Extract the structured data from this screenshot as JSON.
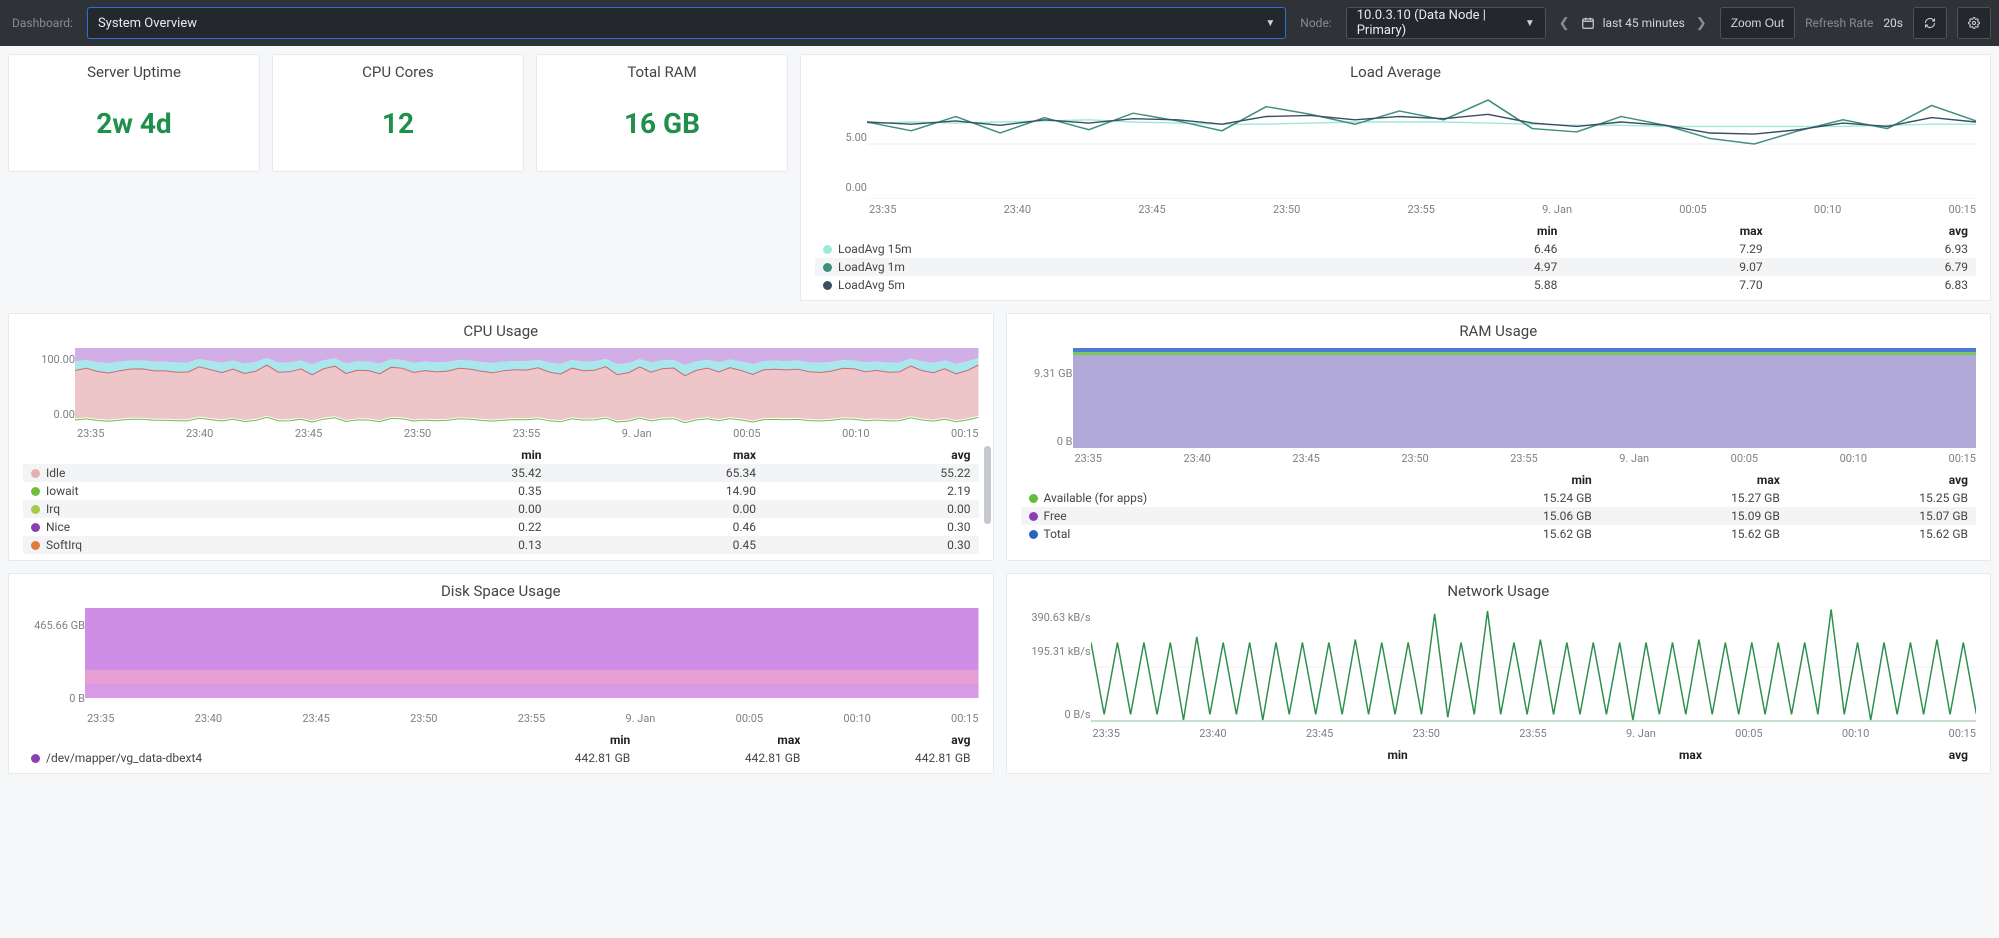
{
  "topbar": {
    "dashboard_lbl": "Dashboard:",
    "dashboard_value": "System Overview",
    "node_lbl": "Node:",
    "node_value": "10.0.3.10 (Data Node | Primary)",
    "range_text": "last 45 minutes",
    "zoom_out": "Zoom Out",
    "refresh_lbl": "Refresh Rate",
    "refresh_val": "20s"
  },
  "stats": {
    "uptime_title": "Server Uptime",
    "uptime_value": "2w 4d",
    "cores_title": "CPU Cores",
    "cores_value": "12",
    "ram_title": "Total RAM",
    "ram_value": "16 GB"
  },
  "xticks": [
    "23:35",
    "23:40",
    "23:45",
    "23:50",
    "23:55",
    "9. Jan",
    "00:05",
    "00:10",
    "00:15"
  ],
  "chart_data": [
    {
      "id": "load",
      "title": "Load Average",
      "type": "line",
      "ylabel": "",
      "yticks": [
        "5.00",
        "0.00"
      ],
      "ylim": [
        0,
        10
      ],
      "x": [
        "23:35",
        "23:40",
        "23:45",
        "23:50",
        "23:55",
        "9. Jan",
        "00:05",
        "00:10",
        "00:15"
      ],
      "series": [
        {
          "name": "LoadAvg 15m",
          "color": "#9fe9d8",
          "min": 6.46,
          "max": 7.29,
          "avg": 6.93,
          "values": [
            6.9,
            7.0,
            6.9,
            7.0,
            7.1,
            7.2,
            7.0,
            6.9,
            6.8,
            6.8,
            6.9,
            7.0,
            7.0,
            7.0,
            6.9,
            6.8,
            6.7,
            6.7,
            6.6,
            6.6,
            6.6,
            6.6,
            6.6,
            6.7,
            6.8,
            6.8
          ]
        },
        {
          "name": "LoadAvg 1m",
          "color": "#3f8f7e",
          "min": 4.97,
          "max": 9.07,
          "avg": 6.79,
          "values": [
            7.0,
            6.2,
            7.5,
            6.0,
            7.4,
            6.3,
            7.8,
            7.1,
            6.2,
            8.4,
            7.7,
            6.8,
            8.0,
            7.2,
            9.0,
            6.4,
            6.1,
            7.5,
            6.7,
            5.5,
            5.0,
            6.2,
            7.2,
            6.4,
            8.5,
            7.1
          ]
        },
        {
          "name": "LoadAvg 5m",
          "color": "#3a4e64",
          "min": 5.88,
          "max": 7.7,
          "avg": 6.83,
          "values": [
            7.0,
            6.8,
            7.1,
            6.7,
            7.2,
            6.9,
            7.3,
            7.2,
            6.8,
            7.5,
            7.6,
            7.2,
            7.5,
            7.3,
            7.7,
            6.9,
            6.6,
            7.0,
            6.7,
            6.0,
            5.9,
            6.3,
            6.9,
            6.6,
            7.4,
            7.0
          ]
        }
      ],
      "legend_cols": [
        "min",
        "max",
        "avg"
      ]
    },
    {
      "id": "cpu",
      "title": "CPU Usage",
      "type": "area-stacked",
      "ylabel": "",
      "yticks": [
        "100.00",
        "0.00"
      ],
      "ylim": [
        0,
        100
      ],
      "x": [
        "23:35",
        "23:40",
        "23:45",
        "23:50",
        "23:55",
        "9. Jan",
        "00:05",
        "00:10",
        "00:15"
      ],
      "series": [
        {
          "name": "Idle",
          "color": "#e7afb3",
          "min": 35.42,
          "max": 65.34,
          "avg": 55.22
        },
        {
          "name": "Iowait",
          "color": "#6fbf3f",
          "min": 0.35,
          "max": 14.9,
          "avg": 2.19
        },
        {
          "name": "Irq",
          "color": "#a7c84b",
          "min": 0.0,
          "max": 0.0,
          "avg": 0.0
        },
        {
          "name": "Nice",
          "color": "#8a3fb3",
          "min": 0.22,
          "max": 0.46,
          "avg": 0.3
        },
        {
          "name": "SoftIrq",
          "color": "#e07b3b",
          "min": 0.13,
          "max": 0.45,
          "avg": 0.3
        }
      ],
      "legend_cols": [
        "min",
        "max",
        "avg"
      ]
    },
    {
      "id": "ram",
      "title": "RAM Usage",
      "type": "area-stacked",
      "ylabel": "",
      "yticks": [
        "9.31 GB",
        "0 B"
      ],
      "ylim": [
        0,
        16
      ],
      "x": [
        "23:35",
        "23:40",
        "23:45",
        "23:50",
        "23:55",
        "9. Jan",
        "00:05",
        "00:10",
        "00:15"
      ],
      "series": [
        {
          "name": "Available (for apps)",
          "color": "#5fbf3b",
          "min": "15.24 GB",
          "max": "15.27 GB",
          "avg": "15.25 GB"
        },
        {
          "name": "Free",
          "color": "#8a3fb3",
          "min": "15.06 GB",
          "max": "15.09 GB",
          "avg": "15.07 GB"
        },
        {
          "name": "Total",
          "color": "#2d62c4",
          "min": "15.62 GB",
          "max": "15.62 GB",
          "avg": "15.62 GB"
        }
      ],
      "legend_cols": [
        "min",
        "max",
        "avg"
      ]
    },
    {
      "id": "disk",
      "title": "Disk Space Usage",
      "type": "area-stacked",
      "ylabel": "",
      "yticks": [
        "465.66 GB",
        "0 B"
      ],
      "ylim": [
        0,
        600
      ],
      "x": [
        "23:35",
        "23:40",
        "23:45",
        "23:50",
        "23:55",
        "9. Jan",
        "00:05",
        "00:10",
        "00:15"
      ],
      "series": [
        {
          "name": "/dev/mapper/vg_data-dbext4",
          "color": "#8a3fb3",
          "min": "442.81 GB",
          "max": "442.81 GB",
          "avg": "442.81 GB"
        }
      ],
      "legend_cols": [
        "min",
        "max",
        "avg"
      ]
    },
    {
      "id": "net",
      "title": "Network Usage",
      "type": "line",
      "ylabel": "",
      "yticks": [
        "390.63 kB/s",
        "195.31 kB/s",
        "0 B/s"
      ],
      "ylim": [
        0,
        400
      ],
      "x": [
        "23:35",
        "23:40",
        "23:45",
        "23:50",
        "23:55",
        "9. Jan",
        "00:05",
        "00:10",
        "00:15"
      ],
      "series": [
        {
          "name": "",
          "color": "#2f8f4c",
          "values": [
            280,
            30,
            280,
            30,
            280,
            30,
            280,
            10,
            300,
            30,
            280,
            30,
            280,
            10,
            280,
            30,
            280,
            30,
            280,
            30,
            290,
            30,
            280,
            30,
            280,
            30,
            380,
            20,
            280,
            30,
            390,
            30,
            280,
            30,
            290,
            30,
            280,
            30,
            280,
            30,
            280,
            10,
            280,
            30,
            280,
            30,
            290,
            30,
            280,
            30,
            280,
            30,
            280,
            30,
            280,
            30,
            395,
            30,
            280,
            10,
            280,
            30,
            280,
            30,
            290,
            30,
            280,
            30
          ]
        }
      ],
      "legend_cols": [
        "min",
        "max",
        "avg"
      ]
    }
  ]
}
